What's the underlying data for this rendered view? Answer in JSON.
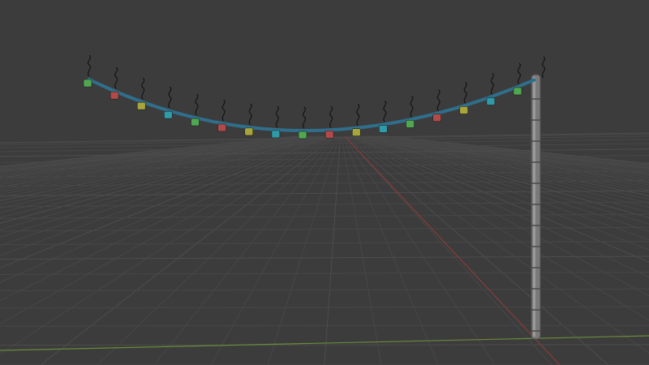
{
  "viewport": {
    "background": "#3c3c3c",
    "grid_color": "#474747",
    "grid_major_color": "#4d4d4d",
    "x_axis_color": "#8a3b3b",
    "y_axis_color": "#6a8a3a"
  },
  "scene": {
    "wire_color": "#2f6f8c",
    "pole_color": "#7a7a7a",
    "wisp_color": "#111111",
    "light_palette": [
      "#4fa84f",
      "#b24a4a",
      "#a8a63a",
      "#2f9aa8"
    ],
    "lights": [
      {
        "color": "green"
      },
      {
        "color": "red"
      },
      {
        "color": "yellow"
      },
      {
        "color": "cyan"
      },
      {
        "color": "green"
      },
      {
        "color": "red"
      },
      {
        "color": "yellow"
      },
      {
        "color": "cyan"
      },
      {
        "color": "green"
      },
      {
        "color": "red"
      },
      {
        "color": "yellow"
      },
      {
        "color": "cyan"
      },
      {
        "color": "green"
      },
      {
        "color": "red"
      },
      {
        "color": "yellow"
      },
      {
        "color": "cyan"
      },
      {
        "color": "green"
      }
    ]
  }
}
